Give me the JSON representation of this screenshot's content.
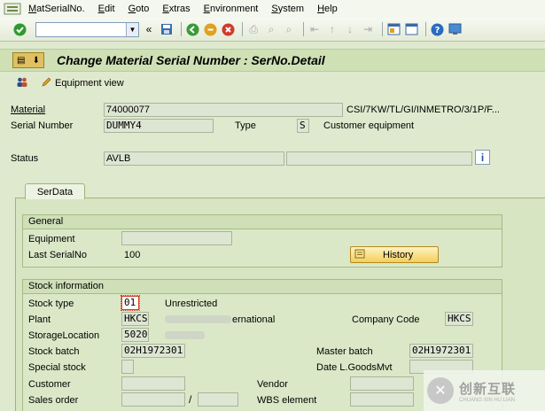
{
  "menu": {
    "items": [
      {
        "label": "MatSerialNo.",
        "key": "m1"
      },
      {
        "label": "Edit",
        "key": "m2"
      },
      {
        "label": "Goto",
        "key": "m3"
      },
      {
        "label": "Extras",
        "key": "m4"
      },
      {
        "label": "Environment",
        "key": "m5"
      },
      {
        "label": "System",
        "key": "m6"
      },
      {
        "label": "Help",
        "key": "m7"
      }
    ]
  },
  "toolbar": {
    "command_value": ""
  },
  "title": "Change Material Serial Number : SerNo.Detail",
  "apptoolbar": {
    "equipment_view": "Equipment view"
  },
  "header": {
    "material_label": "Material",
    "material_value": "74000077",
    "material_desc": "CSI/7KW/TL/GI/INMETRO/3/1P/F...",
    "serial_label": "Serial Number",
    "serial_value": "DUMMY4",
    "type_label": "Type",
    "type_value": "S",
    "type_desc": "Customer equipment",
    "status_label": "Status",
    "status_value": "AVLB",
    "status_extra": ""
  },
  "tab": {
    "label": "SerData"
  },
  "general": {
    "title": "General",
    "equipment_label": "Equipment",
    "equipment_value": "",
    "last_serial_label": "Last SerialNo",
    "last_serial_value": "100",
    "history_button": "History"
  },
  "stock": {
    "title": "Stock information",
    "stock_type_label": "Stock type",
    "stock_type_value": "01",
    "stock_type_desc": "Unrestricted",
    "plant_label": "Plant",
    "plant_value": "HKCS",
    "plant_desc": "ernational",
    "company_code_label": "Company Code",
    "company_code_value": "HKCS",
    "storage_label": "StorageLocation",
    "storage_value": "5020",
    "stock_batch_label": "Stock batch",
    "stock_batch_value": "02H1972301",
    "master_batch_label": "Master batch",
    "master_batch_value": "02H1972301",
    "special_stock_label": "Special stock",
    "special_stock_value": "",
    "goods_mvt_label": "Date L.GoodsMvt",
    "goods_mvt_value": "",
    "customer_label": "Customer",
    "customer_value": "",
    "vendor_label": "Vendor",
    "vendor_value": "",
    "sales_order_label": "Sales order",
    "sales_order_value": "",
    "sales_order_item": "",
    "slash": "/",
    "wbs_label": "WBS element",
    "wbs_value": ""
  },
  "watermark": {
    "text": "创新互联",
    "sub": "CHUANG XIN HU LIAN"
  },
  "colors": {
    "background": "#dfe9ce",
    "title_bar": "#cfe0b5",
    "history_button": "#f3cf5c"
  }
}
